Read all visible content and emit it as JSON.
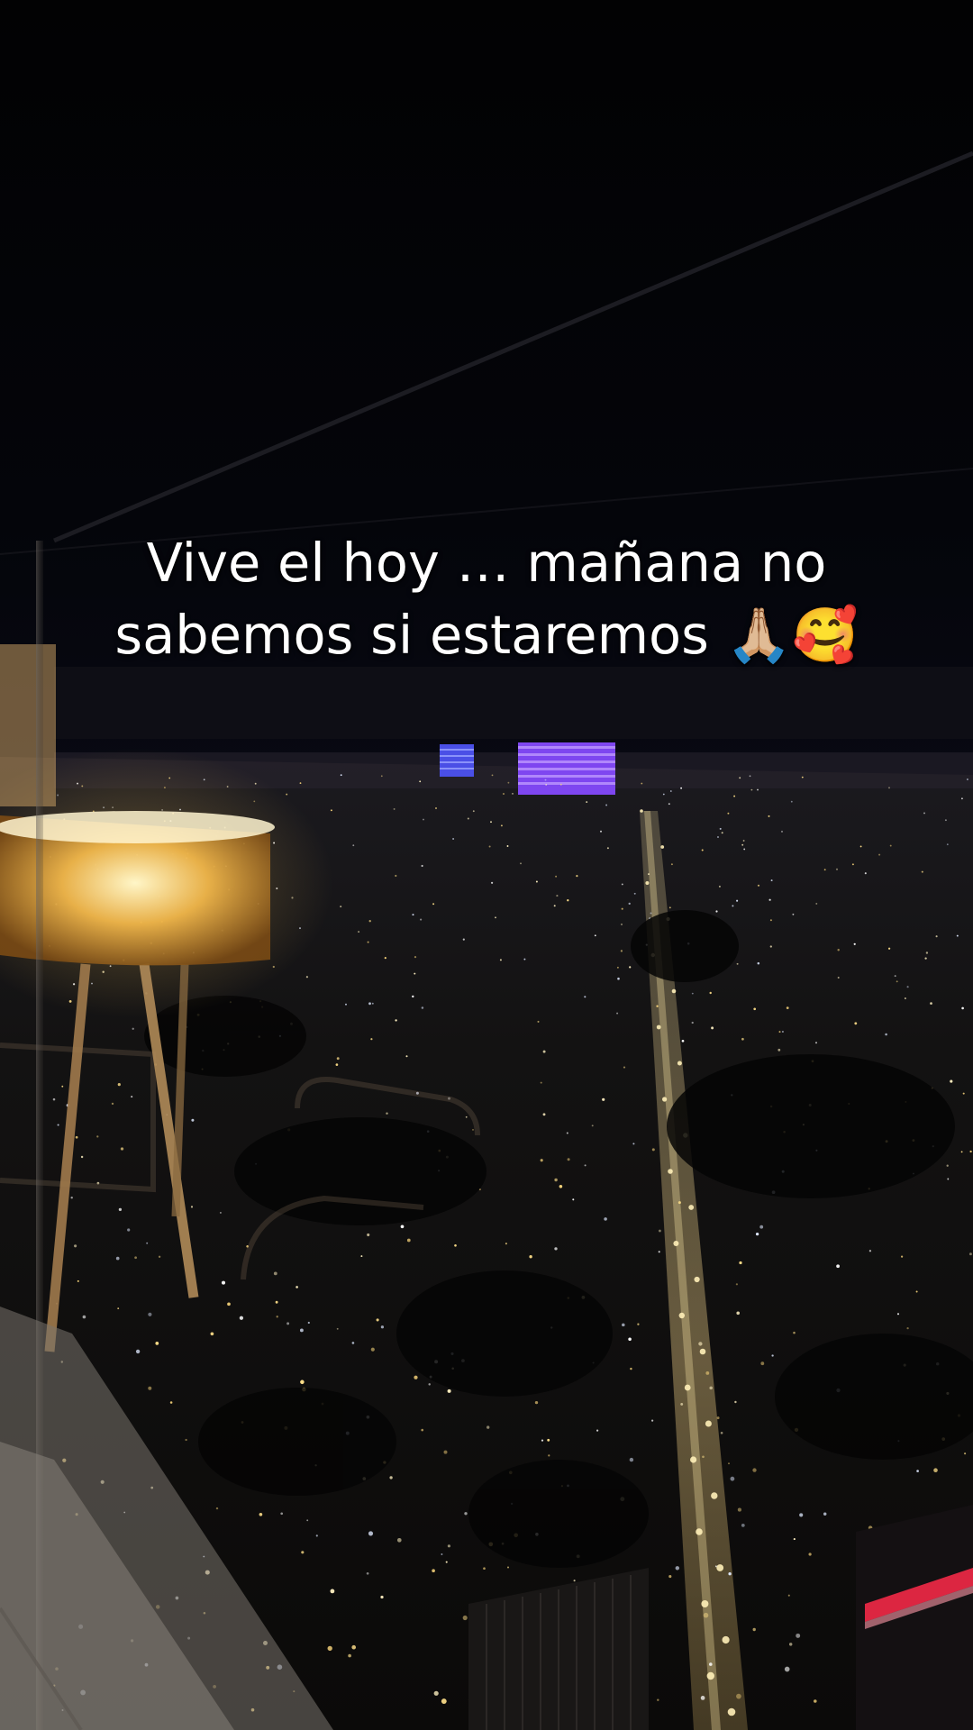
{
  "caption": {
    "line1": "Vive el hoy … mañana no",
    "line2": "sabemos si estaremos 🙏🏼🥰"
  },
  "colors": {
    "sky": "#020203",
    "city_light": "#fff1c2",
    "lamp_glow": "#f7c65a",
    "tower_purple": "#8a4cff",
    "tower_blue": "#4a57ff",
    "neon_red": "#ff2a4a",
    "caption_text": "#ffffff"
  }
}
